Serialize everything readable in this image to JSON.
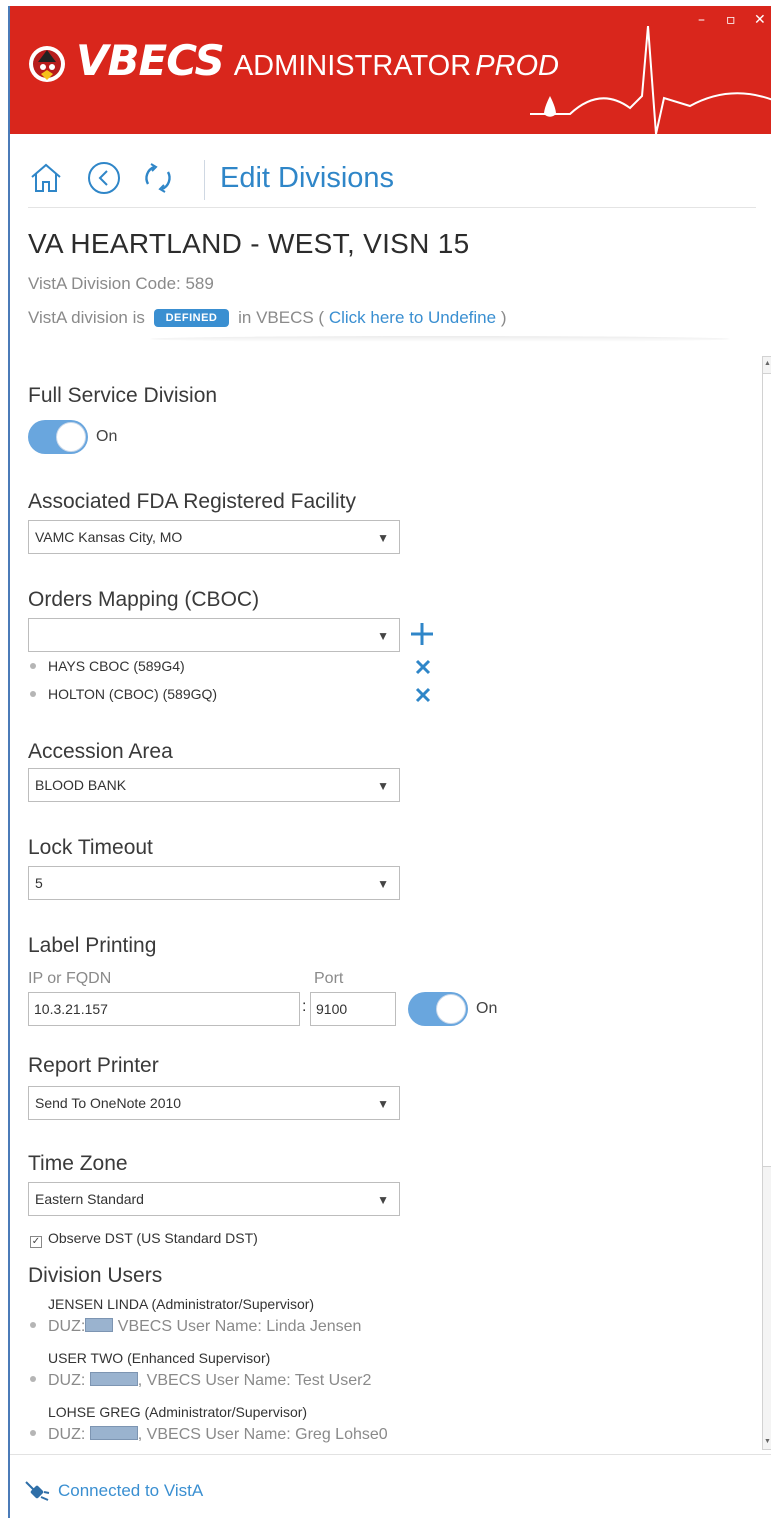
{
  "app": {
    "brand_main": "VBECS",
    "brand_sub": "ADMINISTRATOR",
    "brand_env": "PROD",
    "window_controls": {
      "minimize": "–",
      "maximize": "▫",
      "close": "✕"
    }
  },
  "nav": {
    "icons": [
      "home-icon",
      "back-icon",
      "refresh-icon"
    ],
    "title": "Edit Divisions"
  },
  "division": {
    "name": "VA HEARTLAND - WEST, VISN 15",
    "code_text": "VistA Division Code: 589",
    "status_prefix": "VistA division is",
    "status_badge": "DEFINED",
    "status_suffix": "in VBECS (",
    "undefine_link": "Click here to Undefine",
    "status_close": ")"
  },
  "form": {
    "full_service": {
      "label": "Full Service Division",
      "toggle_text": "On",
      "on": true
    },
    "fda_facility": {
      "label": "Associated FDA Registered Facility",
      "value": "VAMC Kansas City, MO"
    },
    "orders_mapping": {
      "label": "Orders Mapping (CBOC)",
      "value": "",
      "items": [
        "HAYS CBOC (589G4)",
        "HOLTON (CBOC) (589GQ)"
      ]
    },
    "accession_area": {
      "label": "Accession Area",
      "value": "BLOOD BANK"
    },
    "lock_timeout": {
      "label": "Lock Timeout",
      "value": "5"
    },
    "label_printing": {
      "label": "Label Printing",
      "ip_label": "IP or FQDN",
      "port_label": "Port",
      "ip_value": "10.3.21.157",
      "separator": ":",
      "port_value": "9100",
      "toggle_text": "On",
      "on": true
    },
    "report_printer": {
      "label": "Report Printer",
      "value": "Send To OneNote 2010"
    },
    "time_zone": {
      "label": "Time Zone",
      "value": "Eastern Standard",
      "dst_label": "Observe DST (US Standard DST)",
      "dst_checked": true
    },
    "division_users": {
      "label": "Division Users",
      "users": [
        {
          "name": "JENSEN LINDA (Administrator/Supervisor)",
          "duz_prefix": "DUZ:",
          "detail": "VBECS User Name: Linda Jensen"
        },
        {
          "name": "USER TWO (Enhanced Supervisor)",
          "duz_prefix": "DUZ:",
          "detail": ", VBECS User Name: Test User2"
        },
        {
          "name": "LOHSE GREG (Administrator/Supervisor)",
          "duz_prefix": "DUZ:",
          "detail": ", VBECS User Name: Greg Lohse0"
        }
      ]
    }
  },
  "status_bar": {
    "text": "Connected to VistA"
  },
  "colors": {
    "header_red": "#d9261c",
    "accent_blue": "#3a8fd1",
    "toggle_blue": "#69a6de"
  }
}
